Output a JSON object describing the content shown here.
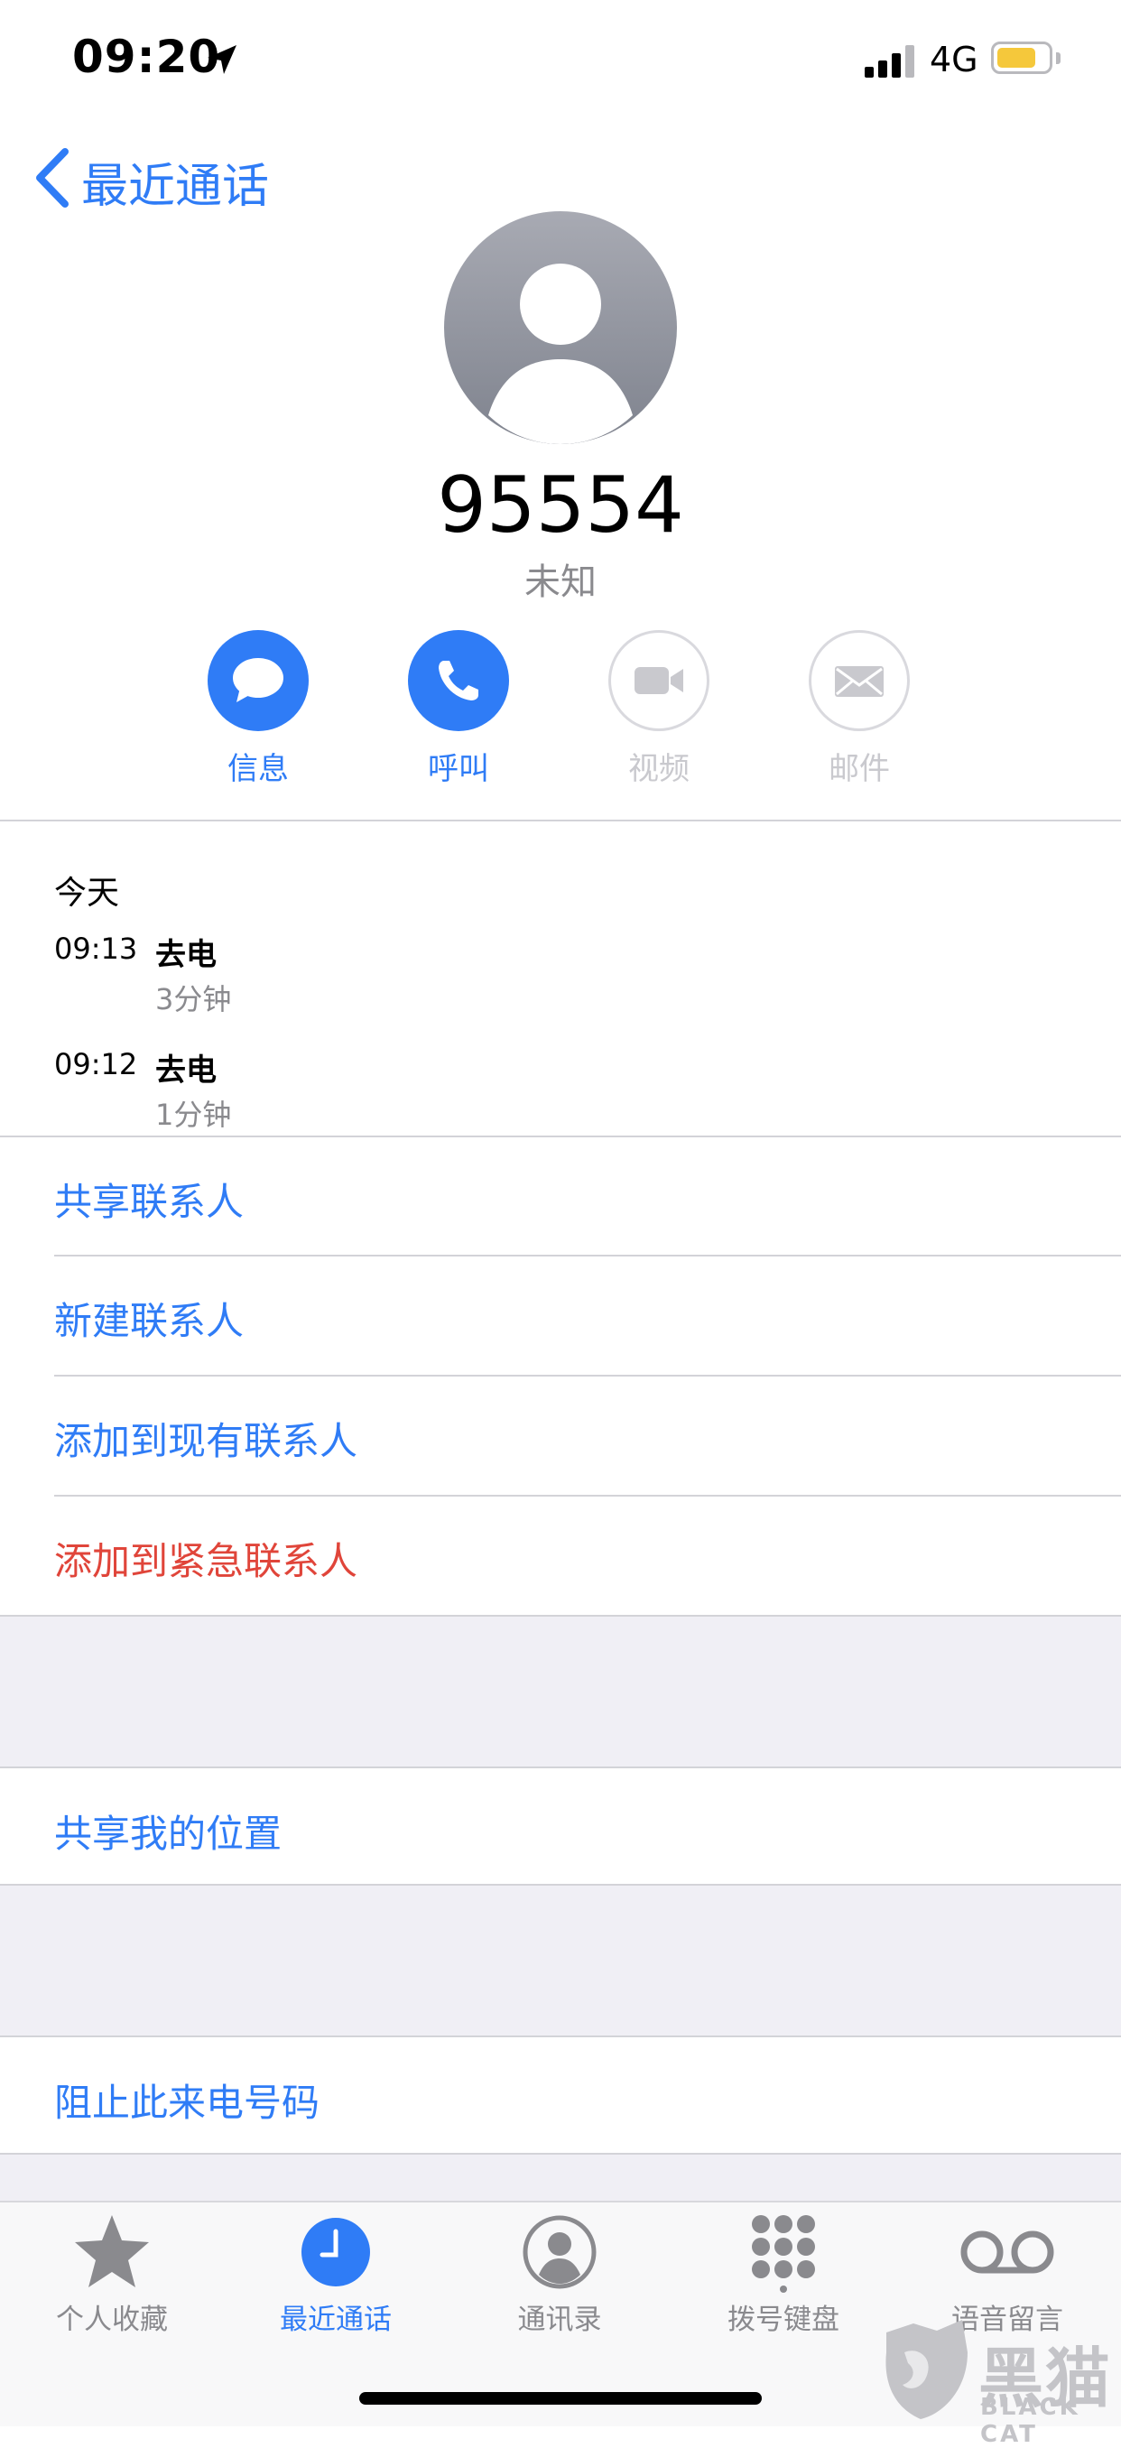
{
  "status_bar": {
    "time": "09:20",
    "network": "4G",
    "battery_level": 0.78,
    "battery_color": "#f5c83b"
  },
  "nav": {
    "back_label": "最近通话"
  },
  "caller": {
    "number": "95554",
    "subtitle": "未知"
  },
  "actions": [
    {
      "label": "信息",
      "icon": "message-icon",
      "enabled": true
    },
    {
      "label": "呼叫",
      "icon": "phone-icon",
      "enabled": true
    },
    {
      "label": "视频",
      "icon": "video-icon",
      "enabled": false
    },
    {
      "label": "邮件",
      "icon": "mail-icon",
      "enabled": false
    }
  ],
  "recent": {
    "day_label": "今天",
    "calls": [
      {
        "time": "09:13",
        "type": "去电",
        "duration": "3分钟"
      },
      {
        "time": "09:12",
        "type": "去电",
        "duration": "1分钟"
      }
    ]
  },
  "options_group1": [
    {
      "label": "共享联系人",
      "color": "#2f7cf6"
    },
    {
      "label": "新建联系人",
      "color": "#2f7cf6"
    },
    {
      "label": "添加到现有联系人",
      "color": "#2f7cf6"
    },
    {
      "label": "添加到紧急联系人",
      "color": "#e0453a"
    }
  ],
  "options_group2": [
    {
      "label": "共享我的位置"
    }
  ],
  "options_group3": [
    {
      "label": "阻止此来电号码"
    }
  ],
  "tabbar": {
    "items": [
      {
        "label": "个人收藏",
        "icon": "star-icon",
        "active": false
      },
      {
        "label": "最近通话",
        "icon": "clock-icon",
        "active": true
      },
      {
        "label": "通讯录",
        "icon": "contact-icon",
        "active": false
      },
      {
        "label": "拨号键盘",
        "icon": "keypad-icon",
        "active": false
      },
      {
        "label": "语音留言",
        "icon": "voicemail-icon",
        "active": false
      }
    ]
  },
  "watermark": {
    "text": "黑猫",
    "sub": "BLACK CAT"
  },
  "colors": {
    "accent": "#2f7cf6",
    "destructive": "#e0453a",
    "separator": "#d3d3d8",
    "group_bg": "#f0eff5"
  }
}
